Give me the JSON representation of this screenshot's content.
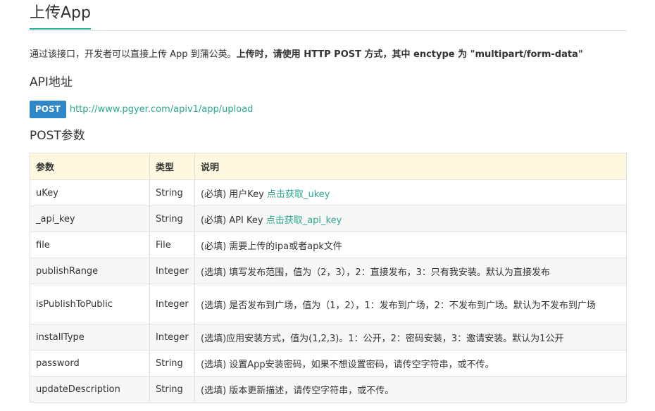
{
  "page": {
    "title": "上传App"
  },
  "intro": {
    "normal": "通过该接口，开发者可以直接上传 App 到蒲公英。",
    "bold": "上传时，请使用 HTTP POST 方式，其中 enctype 为 \"multipart/form-data\""
  },
  "api": {
    "heading": "API地址",
    "method": "POST",
    "url": "http://www.pgyer.com/apiv1/app/upload"
  },
  "params": {
    "heading": "POST参数",
    "headers": [
      "参数",
      "类型",
      "说明"
    ],
    "rows": [
      {
        "name": "uKey",
        "type": "String",
        "desc": "(必填) 用户Key ",
        "link": "点击获取_ukey"
      },
      {
        "name": "_api_key",
        "type": "String",
        "desc": "(必填) API Key ",
        "link": "点击获取_api_key"
      },
      {
        "name": "file",
        "type": "File",
        "desc": "(必填) 需要上传的ipa或者apk文件"
      },
      {
        "name": "publishRange",
        "type": "Integer",
        "desc": "(选填) 填写发布范围，值为（2，3），2：直接发布，3：只有我安装。默认为直接发布"
      },
      {
        "name": "isPublishToPublic",
        "type": "Integer",
        "desc": "(选填) 是否发布到广场，值为（1，2），1：发布到广场，2：不发布到广场。默认为不发布到广场"
      },
      {
        "name": "installType",
        "type": "Integer",
        "desc": "(选填)应用安装方式，值为(1,2,3)。1：公开，2：密码安装，3：邀请安装。默认为1公开"
      },
      {
        "name": "password",
        "type": "String",
        "desc": "(选填) 设置App安装密码，如果不想设置密码，请传空字符串，或不传。"
      },
      {
        "name": "updateDescription",
        "type": "String",
        "desc": "(选填) 版本更新描述，请传空字符串，或不传。"
      }
    ]
  },
  "colors": {
    "accent": "#29b39a",
    "link": "#2aa88f",
    "badge": "#2f86c8",
    "header_bg": "#fdf8df"
  }
}
